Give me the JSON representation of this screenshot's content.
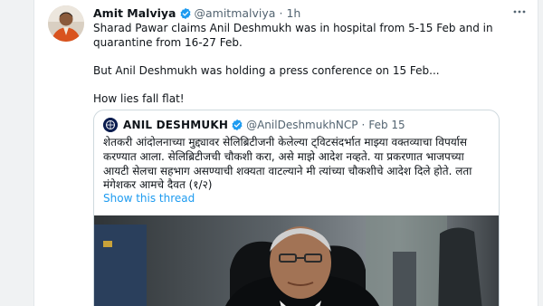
{
  "tweet": {
    "author_name": "Amit Malviya",
    "handle": "@amitmalviya",
    "separator": "·",
    "time": "1h",
    "more_icon": "more-horizontal-icon",
    "paragraphs": [
      "Sharad Pawar claims Anil Deshmukh was in hospital from 5-15 Feb and in quarantine from 16-27 Feb.",
      "But Anil Deshmukh was holding a press conference on 15 Feb...",
      "How lies fall flat!"
    ]
  },
  "quoted_tweet": {
    "author_name": "ANIL DESHMUKH",
    "handle": "@AnilDeshmukhNCP",
    "separator": "·",
    "date": "Feb 15",
    "text": "शेतकरी आंदोलनाच्या मुद्द्यावर सेलिब्रिटीजनी केलेल्या ट्विटसंदर्भात माझ्या वक्तव्याचा विपर्यास करण्यात आला. सेलिब्रिटीजची चौकशी करा, असे माझे आदेश नव्हते. या प्रकरणात भाजपच्या आयटी सेलचा सहभाग असण्याची शक्यता वाटल्याने मी त्यांच्या चौकशीचे आदेश दिले होते. लता मंगेशकर आमचे दैवत (१/२)",
    "show_thread_label": "Show this thread"
  },
  "colors": {
    "link": "#1d9bf0",
    "verified_badge": "#1d9bf0",
    "muted_text": "#536471",
    "border": "#cfd9de"
  }
}
